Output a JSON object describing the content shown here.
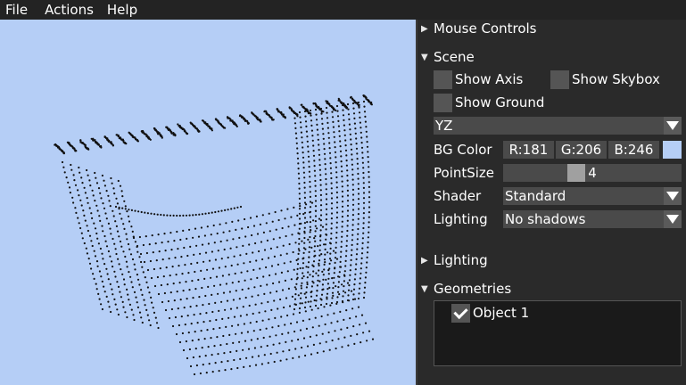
{
  "menu": [
    "File",
    "Actions",
    "Help"
  ],
  "viewport": {
    "background": "#b5cef6"
  },
  "panel": {
    "mouse_controls": "Mouse Controls",
    "scene": {
      "title": "Scene",
      "show_axis": "Show Axis",
      "show_skybox": "Show Skybox",
      "show_ground": "Show Ground",
      "show_axis_checked": false,
      "show_skybox_checked": false,
      "show_ground_checked": false,
      "view_plane": "YZ",
      "bg_color_label": "BG Color",
      "bg_r": "R:181",
      "bg_g": "G:206",
      "bg_b": "B:246",
      "bg_swatch": "#b5cef6",
      "point_size_label": "PointSize",
      "point_size": "4",
      "point_size_fraction": 0.38,
      "shader_label": "Shader",
      "shader": "Standard",
      "lighting_label": "Lighting",
      "lighting": "No shadows"
    },
    "lighting_section": "Lighting",
    "geometries": {
      "title": "Geometries",
      "items": [
        {
          "label": "Object 1",
          "checked": true
        }
      ]
    }
  }
}
